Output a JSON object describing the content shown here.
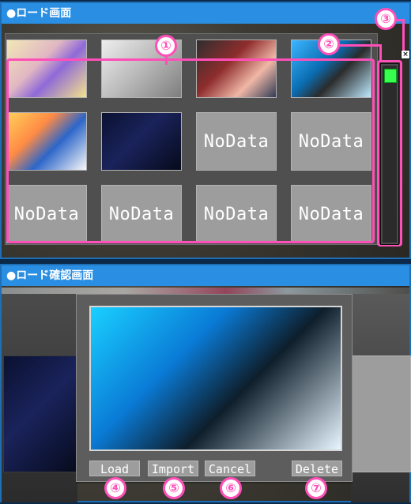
{
  "top_section": {
    "title": "●ロード画面",
    "close_icon": "close-icon",
    "grid": {
      "rows": 3,
      "cols": 4,
      "slots": [
        {
          "label": "",
          "thumb": "thumb-a"
        },
        {
          "label": "",
          "thumb": "thumb-b"
        },
        {
          "label": "",
          "thumb": "thumb-c"
        },
        {
          "label": "",
          "thumb": "thumb-d"
        },
        {
          "label": "",
          "thumb": "thumb-e"
        },
        {
          "label": "",
          "thumb": "thumb-f"
        },
        {
          "label": "NoData",
          "thumb": ""
        },
        {
          "label": "NoData",
          "thumb": ""
        },
        {
          "label": "NoData",
          "thumb": ""
        },
        {
          "label": "NoData",
          "thumb": ""
        },
        {
          "label": "NoData",
          "thumb": ""
        },
        {
          "label": "NoData",
          "thumb": ""
        }
      ]
    },
    "scroll_color": "#38ff4e"
  },
  "bottom_section": {
    "title": "●ロード確認画面",
    "buttons": [
      {
        "label": "Load"
      },
      {
        "label": "Import"
      },
      {
        "label": "Cancel"
      },
      {
        "label": "Delete"
      }
    ]
  },
  "badges": [
    "①",
    "②",
    "③",
    "④",
    "⑤",
    "⑥",
    "⑦"
  ],
  "colors": {
    "header_blue": "#2a8fe3",
    "highlight_pink": "#ff4fb8",
    "button_gray": "#9d9d9d"
  }
}
